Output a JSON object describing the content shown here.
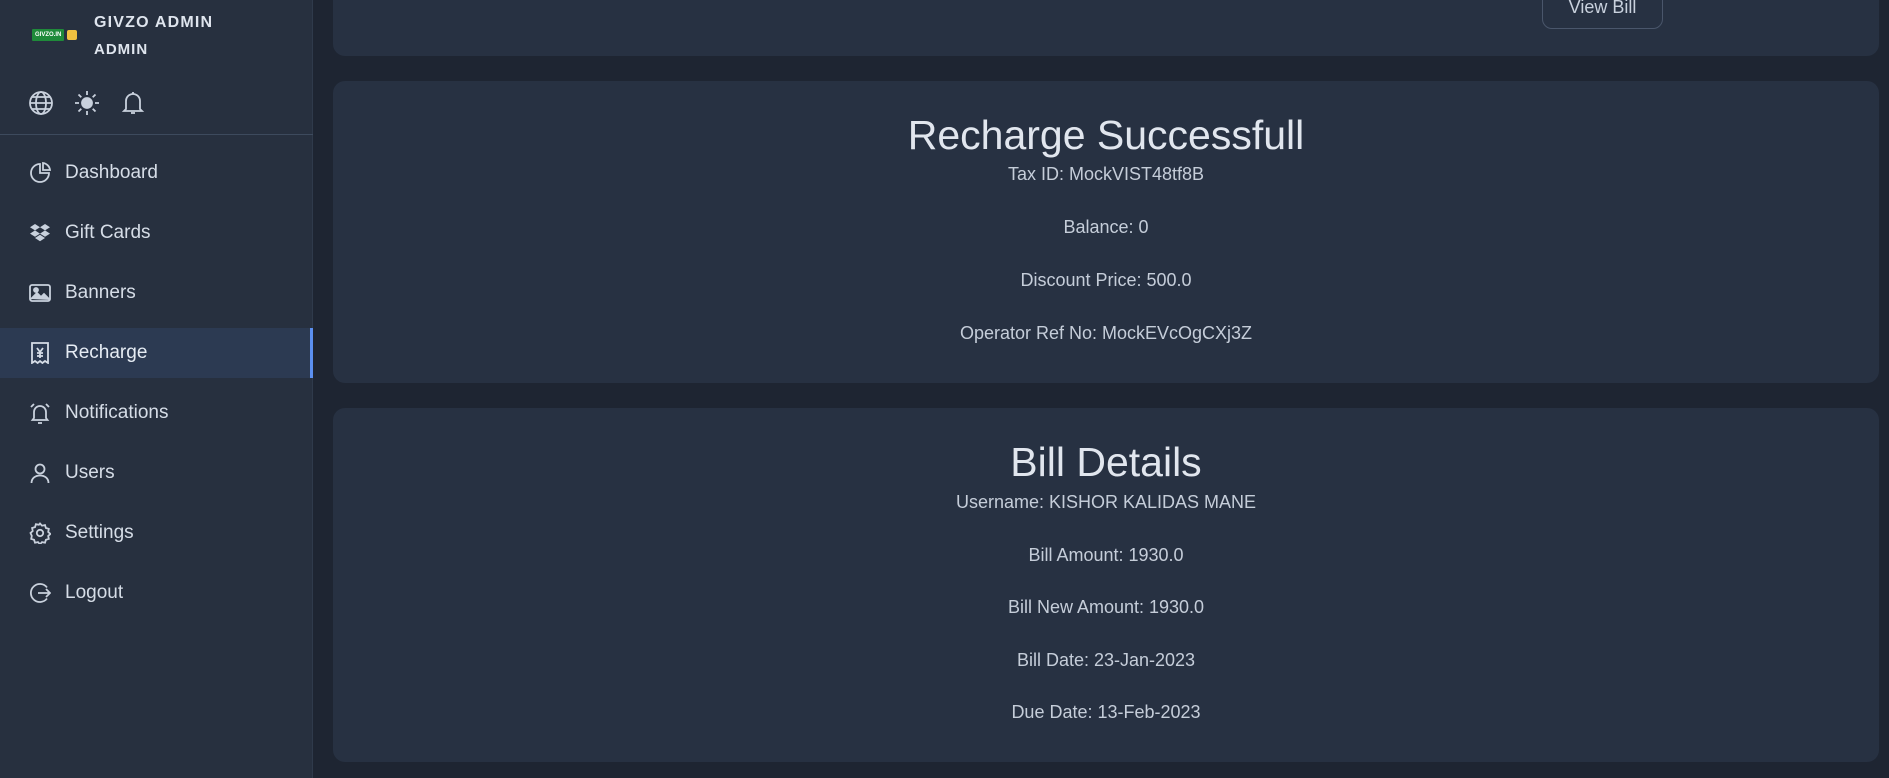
{
  "brand": {
    "logo_text": "GIVZO.IN",
    "name": "GIVZO ADMIN",
    "role": "ADMIN"
  },
  "quick_icons": [
    "globe-icon",
    "sun-icon",
    "bell-icon"
  ],
  "nav": [
    {
      "label": "Dashboard",
      "icon": "pie-chart-icon",
      "active": false
    },
    {
      "label": "Gift Cards",
      "icon": "dropbox-icon",
      "active": false
    },
    {
      "label": "Banners",
      "icon": "image-icon",
      "active": false
    },
    {
      "label": "Recharge",
      "icon": "receipt-yen-icon",
      "active": true
    },
    {
      "label": "Notifications",
      "icon": "alarm-bell-icon",
      "active": false
    },
    {
      "label": "Users",
      "icon": "user-icon",
      "active": false
    },
    {
      "label": "Settings",
      "icon": "gear-icon",
      "active": false
    },
    {
      "label": "Logout",
      "icon": "logout-icon",
      "active": false
    }
  ],
  "top_card": {
    "view_bill_label": "View Bill"
  },
  "recharge": {
    "title": "Recharge Successfull",
    "tax_id": "Tax ID: MockVIST48tf8B",
    "balance": "Balance: 0",
    "discount_price": "Discount Price: 500.0",
    "operator_ref": "Operator Ref No: MockEVcOgCXj3Z"
  },
  "bill": {
    "title": "Bill Details",
    "username": "Username: KISHOR KALIDAS MANE",
    "bill_amount": "Bill Amount: 1930.0",
    "bill_new_amount": "Bill New Amount: 1930.0",
    "bill_date": "Bill Date: 23-Jan-2023",
    "due_date": "Due Date: 13-Feb-2023"
  },
  "colors": {
    "accent": "#5b8ff0",
    "sidebar": "#27303f",
    "background": "#1e2532",
    "card": "#273142"
  }
}
